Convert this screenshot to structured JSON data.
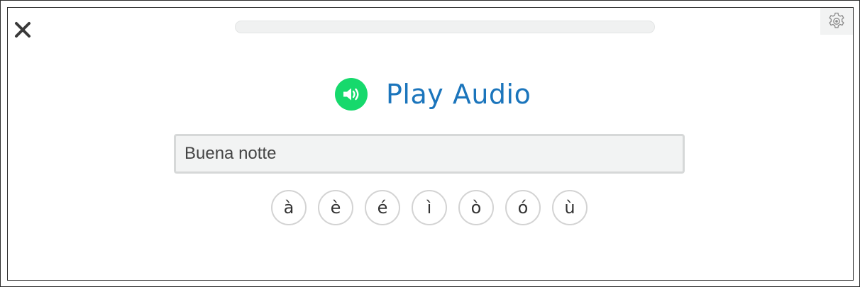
{
  "header": {
    "close_icon": "close-icon",
    "settings_icon": "gear-icon",
    "progress": 0
  },
  "audio": {
    "icon": "speaker-icon",
    "label": "Play Audio",
    "accent_color": "#16d96c",
    "label_color": "#1b75bc"
  },
  "answer": {
    "value": "Buena notte"
  },
  "accents": [
    "à",
    "è",
    "é",
    "ì",
    "ò",
    "ó",
    "ù"
  ]
}
